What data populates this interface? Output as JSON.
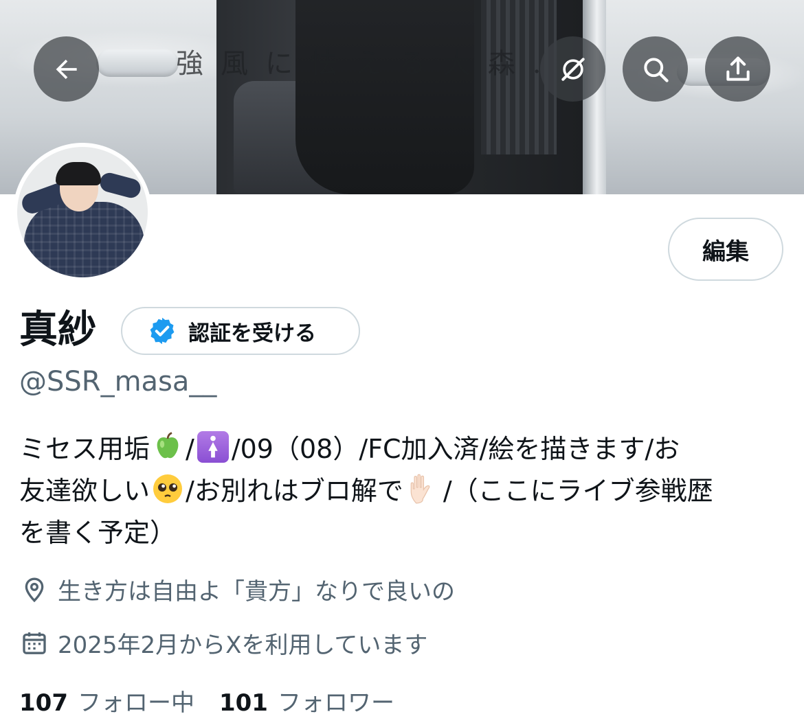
{
  "banner": {
    "caption": "強風に怯える大森.",
    "buttons": {
      "back_icon": "arrow-left-icon",
      "grok_icon": "grok-icon",
      "search_icon": "search-icon",
      "share_icon": "share-icon"
    }
  },
  "profile": {
    "edit_label": "編集",
    "display_name": "真紗",
    "verify_label": "認証を受ける",
    "handle": "@SSR_masa__",
    "bio": {
      "line1_a": "ミセス用垢",
      "line1_b": "/",
      "line1_c": "/09（08）/FC加入済/絵を描きます/お",
      "line2_a": "友達欲しい",
      "line2_b": "/お別れはブロ解で",
      "line2_c": "/（ここにライブ参戦歴",
      "line3": "を書く予定）"
    },
    "location": "生き方は自由よ「貴方」なりで良いの",
    "joined": "2025年2月からXを利用しています",
    "following_count": "107",
    "following_label": "フォロー中",
    "followers_count": "101",
    "followers_label": "フォロワー"
  },
  "colors": {
    "text_primary": "#0f1419",
    "text_secondary": "#536471",
    "border": "#cfd9de",
    "verified_blue": "#1d9bf0"
  }
}
